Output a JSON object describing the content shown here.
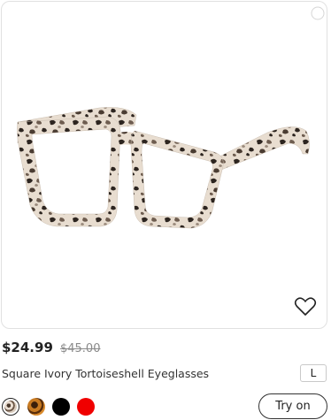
{
  "product": {
    "price": "$24.99",
    "original_price": "$45.00",
    "title": "Square Ivory Tortoiseshell Eyeglasses",
    "size": "L",
    "image_icon": "eyeglasses-ivory-tortoiseshell",
    "favorite_icon": "heart-outline-icon"
  },
  "swatches": [
    {
      "name": "ivory-tortoiseshell",
      "color": "#e9ddd1",
      "selected": true
    },
    {
      "name": "tortoiseshell",
      "color": "#c77a22",
      "selected": false
    },
    {
      "name": "black",
      "color": "#000000",
      "selected": false
    },
    {
      "name": "red",
      "color": "#f00000",
      "selected": false
    }
  ],
  "actions": {
    "try_on_label": "Try on"
  }
}
